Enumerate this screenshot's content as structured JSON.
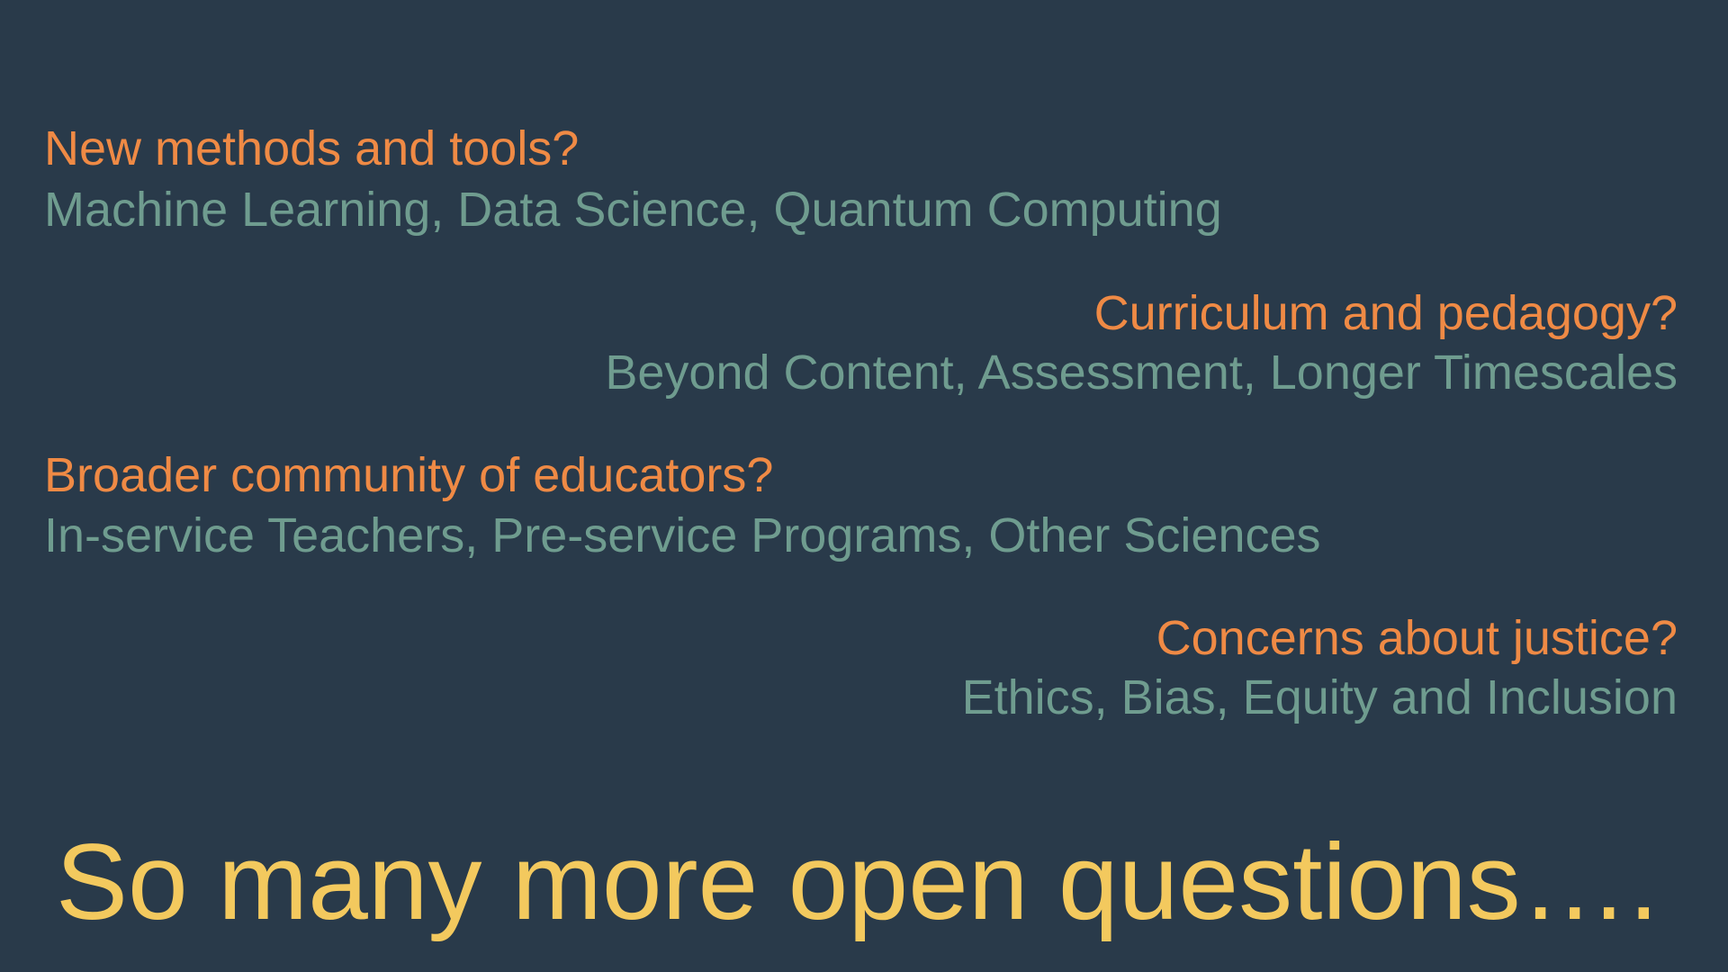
{
  "slide": {
    "items": [
      {
        "question": "New methods and tools?",
        "detail": "Machine Learning, Data Science, Quantum Computing"
      },
      {
        "question": "Curriculum and pedagogy?",
        "detail": "Beyond Content, Assessment, Longer Timescales"
      },
      {
        "question": "Broader community of educators?",
        "detail": "In-service Teachers, Pre-service Programs, Other Sciences"
      },
      {
        "question": "Concerns about justice?",
        "detail": "Ethics, Bias, Equity and Inclusion"
      }
    ],
    "closing": "So many more open questions…."
  },
  "colors": {
    "background": "#293a4a",
    "question": "#ef8a45",
    "detail": "#6f9c8f",
    "closing": "#f3c95e"
  }
}
